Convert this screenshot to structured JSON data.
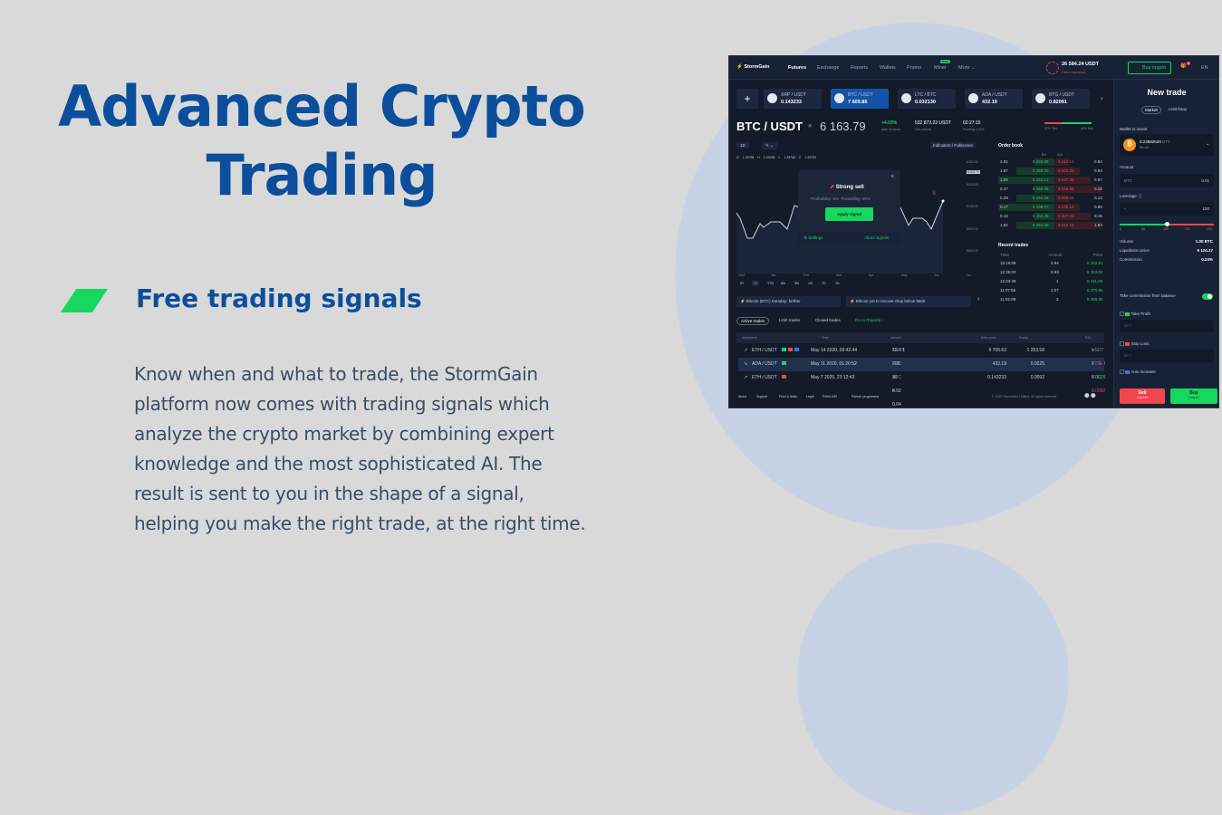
{
  "hero": {
    "title": "Advanced Crypto Trading",
    "subtitle": "Free trading signals",
    "description": "Know when and what to trade, the StormGain platform now comes with trading signals which analyze the crypto market by combining expert knowledge and the most sophisticated AI. The result is sent to you in the shape of a signal, helping you make the right trade, at the right time."
  },
  "colors": {
    "brand_blue": "#0b4f9c",
    "accent_green": "#17d75f",
    "sell_red": "#e8484e",
    "background": "#d9d9d9",
    "app_bg": "#131b2a"
  },
  "app": {
    "logo": "StormGain",
    "nav": [
      "Futures",
      "Exchange",
      "Reports",
      "Wallets",
      "Promo",
      "Miner",
      "More"
    ],
    "miner_badge": "Beta",
    "balance": "26 584.24 USDT",
    "account": "Demo account",
    "buy_crypto": "Buy crypto",
    "lang": "EN",
    "notif_count": "1",
    "tickers": [
      {
        "pair": "XRP / USDT",
        "price": "0.143233"
      },
      {
        "pair": "BTC / USDT",
        "price": "7 609.86"
      },
      {
        "pair": "LTC / BTC",
        "price": "0.032130"
      },
      {
        "pair": "ADA / USDT",
        "price": "432.19"
      },
      {
        "pair": "BTG / USDT",
        "price": "0.82091"
      }
    ],
    "instrument": {
      "pair": "BTC / USDT",
      "price": "6 163.79",
      "change": "+4.03%",
      "change_label": "past 24 hours",
      "volume": "532 873.23 USDT",
      "volume_label": "24h volume",
      "funding_time": "02:27:15",
      "funding_label": "Funding 0.01%",
      "sell_pct": "37% Sell",
      "buy_pct": "63% Buy"
    },
    "chart": {
      "interval": "1D",
      "indicators": "Indicators / Fullscreen",
      "ohlc": [
        "O 1.23756",
        "H 1.23786",
        "L 1.23748",
        "C 1.23792"
      ],
      "y_ticks": [
        "6300.00",
        "6200.00",
        "6100.00",
        "5900.00",
        "5800.00"
      ],
      "price_tag": "6163.79",
      "x_ticks": [
        "GMT",
        "Jan",
        "Feb",
        "Mar",
        "Apr",
        "May",
        "Jun",
        "Jul"
      ],
      "ranges": [
        "5Y",
        "1Y",
        "YTD",
        "6M",
        "3M",
        "1M",
        "7D",
        "1D"
      ],
      "active_range": "1Y"
    },
    "signal": {
      "title": "Strong sell",
      "profitability": "Profitability: 6%",
      "probability": "Probability: 80%",
      "apply": "Apply signal",
      "settings": "Settings",
      "about": "About signals"
    },
    "news": [
      "Bitcoin (BTC) Intraday: further",
      "Bitcoin yet to recover drop below 9500"
    ],
    "order_book": {
      "title": "Order book",
      "headers": [
        "Bid",
        "Ask"
      ],
      "rows": [
        [
          "2.81",
          "6 256.05",
          "6 112.14",
          "0.84"
        ],
        [
          "1.97",
          "6 259.00",
          "6 253.00",
          "0.93"
        ],
        [
          "1.04",
          "6 153.13",
          "6 247.35",
          "0.57"
        ],
        [
          "0.47",
          "6 155.05",
          "6 218.35",
          "0.18"
        ],
        [
          "0.29",
          "6 154.15",
          "6 288.56",
          "0.13"
        ],
        [
          "0.17",
          "6 108.67",
          "6 235.14",
          "0.85"
        ],
        [
          "0.13",
          "6 155.25",
          "6 207.03",
          "0.15"
        ],
        [
          "1.62",
          "6 254.00",
          "6 212.15",
          "1.63"
        ]
      ]
    },
    "recent_trades": {
      "title": "Recent trades",
      "headers": [
        "Time",
        "Amount",
        "Price"
      ],
      "rows": [
        [
          "13:16:08",
          "0.84",
          "6 252.91"
        ],
        [
          "12:35:03",
          "0.93",
          "6 313.03"
        ],
        [
          "12:23:45",
          "1",
          "6 311.50"
        ],
        [
          "11:07:56",
          "1.07",
          "6 370.85"
        ],
        [
          "11:02:08",
          "2",
          "6 399.36"
        ]
      ]
    },
    "trades": {
      "tabs": [
        "Active trades",
        "Limit trades",
        "Closed trades"
      ],
      "reports_link": "Go to Reports",
      "headers": [
        "Instrument",
        "Time",
        "Amount",
        "Entry price",
        "Equity",
        "P&L"
      ],
      "rows": [
        {
          "instrument": "ETH / USDT",
          "time": "May 14 2020, 09:42:44",
          "amount": "15 × 1 000.00",
          "amount_unit": "USDT",
          "entry": "9 706.63",
          "equity": "1 253.58",
          "pnl": "+ 253.58",
          "pnl_unit": "USDT"
        },
        {
          "instrument": "ADA / USDT",
          "time": "May 11 2020, 01:20:52",
          "amount": "200 × 0.02",
          "amount_unit": "BTC",
          "entry": "432.19",
          "equity": "0.0225",
          "pnl": "+ 0.0025",
          "pnl_unit": "BTC"
        },
        {
          "instrument": "ETH / USDT",
          "time": "May 7 2020, 23:12:43",
          "amount": "30 × 0.04",
          "amount_unit": "BTC",
          "entry": "0.143233",
          "equity": "0.0092",
          "pnl": "- 0.0092",
          "pnl_unit": "BTC"
        }
      ]
    },
    "footer": {
      "links": [
        "About",
        "Support",
        "Fees & limits",
        "Legal",
        "Public API",
        "Partner programme"
      ],
      "copyright": "© 2020 StormGain Limited. All rights reserved."
    },
    "new_trade": {
      "title": "New trade",
      "tabs": [
        "Market",
        "Limit/Stop"
      ],
      "wallet_label": "Wallet to invest",
      "wallet_amount": "0.23582520",
      "wallet_unit": "BTC",
      "wallet_name": "Bitcoin",
      "amount_label": "Amount",
      "amount_unit": "BTC",
      "amount_value": "0.01",
      "leverage_label": "Leverage",
      "leverage_minus": "-",
      "leverage_value": "100",
      "leverage_ticks": [
        "0",
        "50",
        "100",
        "150",
        "200"
      ],
      "leverage_fraction": 0.5,
      "volume_label": "Volume",
      "volume": "1.00 BTC",
      "liq_label": "Liquidation price",
      "liq": "9 124.17",
      "commission_label": "Commission",
      "commission": "0.24%",
      "take_commission": "Take commission from balance",
      "take_commission_on": true,
      "take_profit": "Take Profit",
      "stop_loss": "Stop Loss",
      "auto_increase": "Auto increase",
      "placeholder": "BTC",
      "sell": "Sell",
      "sell_price": "6 007.96",
      "buy": "Buy",
      "buy_price": "6 282.07"
    }
  }
}
